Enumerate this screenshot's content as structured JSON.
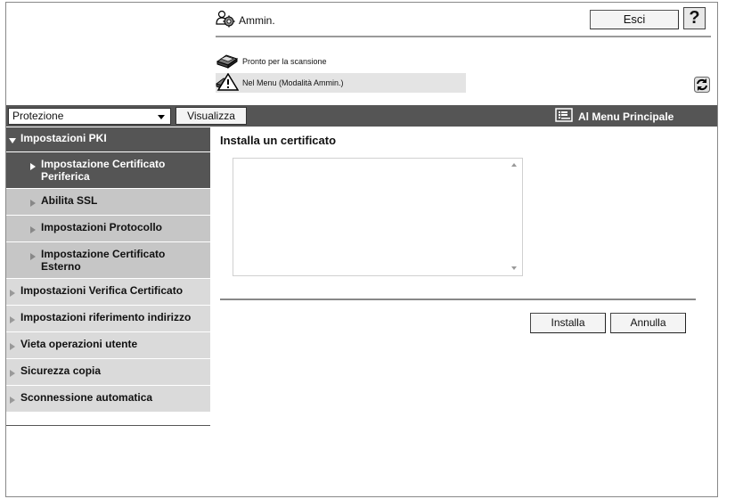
{
  "header": {
    "user_label": "Ammin.",
    "logout_label": "Esci",
    "help_label": "?"
  },
  "status": {
    "scan_status": "Pronto per la scansione",
    "mode_status": "Nel Menu (Modalità Ammin.)"
  },
  "menubar": {
    "category_selected": "Protezione",
    "view_button": "Visualizza",
    "main_menu_label": "Al Menu Principale"
  },
  "sidebar": {
    "items": [
      {
        "label": "Impostazioni PKI",
        "state": "open"
      },
      {
        "label": "Impostazione Certificato Periferica",
        "state": "active"
      },
      {
        "label": "Abilita SSL",
        "state": "sub"
      },
      {
        "label": "Impostazioni Protocollo",
        "state": "sub"
      },
      {
        "label": "Impostazione Certificato Esterno",
        "state": "sub"
      },
      {
        "label": "Impostazioni Verifica Certificato",
        "state": "closed"
      },
      {
        "label": "Impostazioni riferimento indirizzo",
        "state": "closed"
      },
      {
        "label": "Vieta operazioni utente",
        "state": "closed"
      },
      {
        "label": "Sicurezza copia",
        "state": "closed"
      },
      {
        "label": "Sconnessione automatica",
        "state": "closed"
      }
    ]
  },
  "main": {
    "title": "Installa un certificato",
    "certificate_value": "",
    "install_button": "Installa",
    "cancel_button": "Annulla"
  },
  "colors": {
    "menubar_bg": "#555555",
    "sidebar_bg": "#dadada",
    "subitem_bg": "#c6c6c6"
  }
}
